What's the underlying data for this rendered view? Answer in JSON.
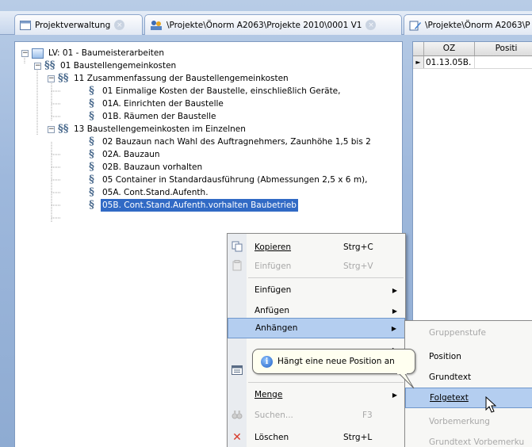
{
  "tabs": [
    {
      "label": "Projektverwaltung",
      "icon": "document-tab-icon"
    },
    {
      "label": "\\Projekte\\Önorm A2063\\Projekte 2010\\0001 V1",
      "icon": "folder-users-icon"
    },
    {
      "label": "\\Projekte\\Önorm A2063\\P",
      "icon": "document-edit-icon"
    }
  ],
  "tree": [
    {
      "label": "LV: 01 - Baumeisterarbeiten",
      "icon": "lv-icon",
      "expander": "−"
    },
    {
      "label": "01 Baustellengemeinkosten",
      "icon": "section-icon",
      "expander": "−"
    },
    {
      "label": "11 Zusammenfassung der Baustellengemeinkosten",
      "icon": "section-icon",
      "expander": "−"
    },
    {
      "label": "01 Einmalige Kosten der Baustelle, einschließlich Geräte,",
      "icon": "paragraph-star-icon"
    },
    {
      "label": "01A.  Einrichten der Baustelle",
      "icon": "paragraph-icon"
    },
    {
      "label": "01B.  Räumen der Baustelle",
      "icon": "paragraph-icon"
    },
    {
      "label": "13 Baustellengemeinkosten im Einzelnen",
      "icon": "section-icon",
      "expander": "−"
    },
    {
      "label": "02 Bauzaun nach Wahl des Auftragnehmers, Zaunhöhe 1,5 bis 2",
      "icon": "paragraph-star-icon"
    },
    {
      "label": "02A.  Bauzaun",
      "icon": "paragraph-icon"
    },
    {
      "label": "02B.  Bauzaun vorhalten",
      "icon": "paragraph-icon"
    },
    {
      "label": "05 Container in Standardausführung (Abmessungen 2,5 x 6 m),",
      "icon": "paragraph-star-icon"
    },
    {
      "label": "05A.  Cont.Stand.Aufenth.",
      "icon": "paragraph-icon"
    },
    {
      "label": "05B.  Cont.Stand.Aufenth.vorhalten Baubetrieb",
      "icon": "paragraph-icon",
      "selected": true
    }
  ],
  "grid": {
    "headers": [
      "OZ",
      "Positi"
    ],
    "rows": [
      {
        "marker": "►",
        "oz": "01.13.05B."
      }
    ]
  },
  "context_menu": {
    "items": [
      {
        "label": "Kopieren",
        "shortcut": "Strg+C",
        "icon": "copy-icon",
        "disabled": false
      },
      {
        "label": "Einfügen",
        "shortcut": "Strg+V",
        "icon": "paste-icon",
        "disabled": true
      },
      {
        "label": "Einfügen",
        "submenu": true
      },
      {
        "label": "Anfügen",
        "submenu": true
      },
      {
        "label": "Anhängen",
        "submenu": true,
        "highlighted": true
      },
      {
        "label": "",
        "submenu": true
      },
      {
        "label": "",
        "icon": "window-icon"
      },
      {
        "label": "Menge",
        "submenu": true
      },
      {
        "label": "Suchen...",
        "shortcut": "F3",
        "icon": "binoculars-icon",
        "disabled": true
      },
      {
        "label": "Löschen",
        "shortcut": "Strg+L",
        "icon": "delete-icon",
        "disabled": false
      }
    ]
  },
  "submenu": {
    "items": [
      {
        "label": "Gruppenstufe",
        "disabled": true
      },
      {
        "label": "Position",
        "disabled": false
      },
      {
        "label": "Grundtext",
        "disabled": false
      },
      {
        "label": "Folgetext",
        "disabled": false,
        "highlighted": true
      },
      {
        "label": "Vorbemerkung",
        "disabled": true
      },
      {
        "label": "Grundtext Vorbemerku",
        "disabled": true
      }
    ]
  },
  "tooltip": {
    "text": "Hängt eine neue Position an",
    "icon": "info-icon"
  },
  "colors": {
    "selection": "#316ac5",
    "menu_highlight": "#b4cef0",
    "delete_icon": "#d83a2a"
  }
}
